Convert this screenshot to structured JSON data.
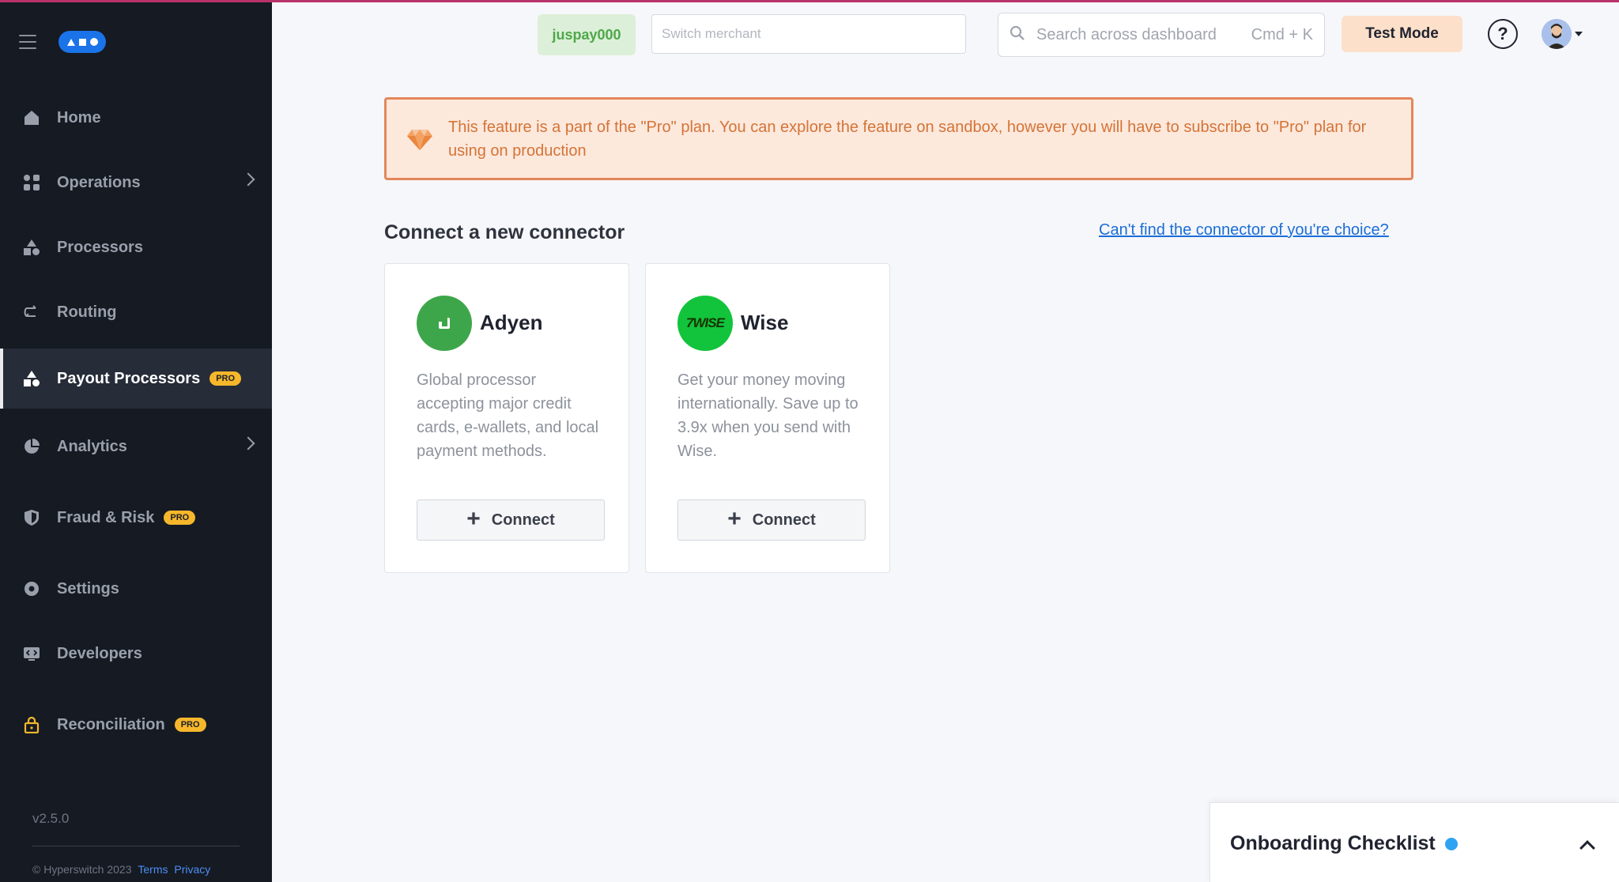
{
  "sidebar": {
    "items": [
      {
        "label": "Home",
        "icon": "home-icon"
      },
      {
        "label": "Operations",
        "icon": "operations-icon"
      },
      {
        "label": "Processors",
        "icon": "processors-icon"
      },
      {
        "label": "Routing",
        "icon": "routing-icon"
      },
      {
        "label": "Payout Processors",
        "icon": "payout-icon",
        "badge": "PRO",
        "active": true
      },
      {
        "label": "Analytics",
        "icon": "analytics-icon"
      },
      {
        "label": "Fraud & Risk",
        "icon": "shield-icon",
        "badge": "PRO"
      },
      {
        "label": "Settings",
        "icon": "gear-icon"
      },
      {
        "label": "Developers",
        "icon": "developers-icon"
      },
      {
        "label": "Reconciliation",
        "icon": "lock-icon",
        "badge": "PRO"
      }
    ],
    "version": "v2.5.0",
    "footer": {
      "copyright": "Hyperswitch 2023",
      "terms": "Terms",
      "privacy": "Privacy"
    }
  },
  "topbar": {
    "merchant_id": "juspay000",
    "switch_placeholder": "Switch merchant",
    "search_placeholder": "Search across dashboard",
    "search_shortcut": "Cmd + K",
    "test_mode": "Test Mode",
    "help": "?"
  },
  "banner": {
    "text": "This feature is a part of the \"Pro\" plan. You can explore the feature on sandbox, however you will have to subscribe to \"Pro\" plan for using on production"
  },
  "main": {
    "title": "Connect a new connector",
    "cant_find": "Can't find the connector of you're choice?",
    "connectors": [
      {
        "name": "Adyen",
        "description": "Global processor accepting major credit cards, e-wallets, and local payment methods.",
        "button": "Connect",
        "logo_color": "#3ea64a"
      },
      {
        "name": "Wise",
        "description": "Get your money moving internationally. Save up to 3.9x when you send with Wise.",
        "button": "Connect",
        "logo_color": "#12c43b",
        "logo_text": "7WISE"
      }
    ]
  },
  "onboarding": {
    "title": "Onboarding Checklist"
  },
  "colors": {
    "accent": "#1a73e8",
    "banner_bg": "#fde8dc",
    "banner_border": "#e3875a",
    "pro_badge": "#f6b72b"
  }
}
